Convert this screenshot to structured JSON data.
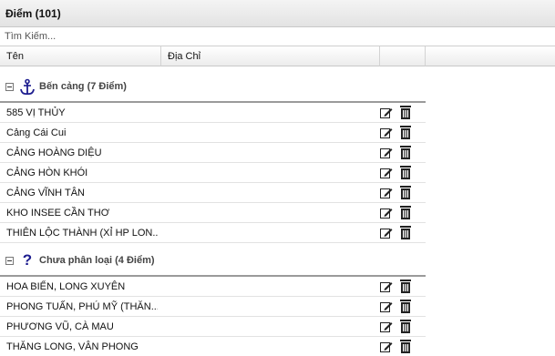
{
  "panel": {
    "title": "Điểm (101)"
  },
  "search": {
    "placeholder": "Tìm Kiếm..."
  },
  "columns": [
    "Tên",
    "Địa Chỉ"
  ],
  "groups": [
    {
      "label": "Bến cảng (7 Điểm)",
      "icon": "anchor-icon",
      "rows": [
        "585 VỊ THỦY",
        "Cảng Cái Cui",
        "CẢNG HOÀNG DIỆU",
        "CẢNG HÒN KHÓI",
        "CẢNG VĨNH TÂN",
        "KHO INSEE CẦN THƠ",
        "THIÊN LỘC THÀNH (XỈ HP LON..."
      ]
    },
    {
      "label": "Chưa phân loại (4 Điểm)",
      "icon": "question-icon",
      "rows": [
        "HOA BIỂN, LONG XUYÊN",
        "PHONG TUẤN, PHÚ MỸ (THĂN...",
        "PHƯƠNG VŨ, CÀ MAU",
        "THĂNG LONG, VÂN PHONG"
      ]
    }
  ]
}
